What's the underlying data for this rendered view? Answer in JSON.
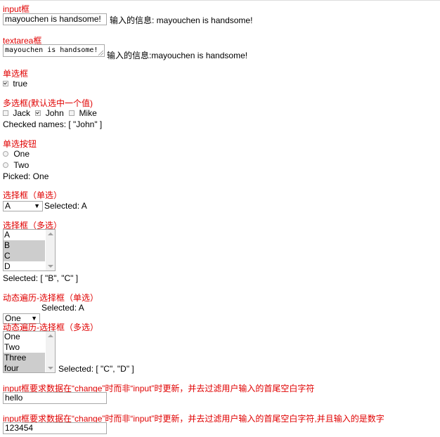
{
  "input_section": {
    "label": "input框",
    "value": "mayouchen is handsome!",
    "info": "输入的信息: mayouchen is handsome!"
  },
  "textarea_section": {
    "label": "textarea框",
    "value": "mayouchen is handsome!",
    "info": "输入的信息:mayouchen is handsome!"
  },
  "single_checkbox": {
    "label": "单选框",
    "text": "true",
    "checked": true
  },
  "multi_checkbox": {
    "label": "多选框(默认选中一个值)",
    "items": [
      {
        "name": "Jack",
        "checked": false
      },
      {
        "name": "John",
        "checked": true
      },
      {
        "name": "Mike",
        "checked": false
      }
    ],
    "result": "Checked names: [ \"John\" ]"
  },
  "radio_section": {
    "label": "单选按钮",
    "items": [
      {
        "name": "One",
        "checked": false
      },
      {
        "name": "Two",
        "checked": false
      }
    ],
    "result": "Picked: One"
  },
  "select_single": {
    "label": "选择框（单选）",
    "value": "A",
    "result": "Selected: A"
  },
  "select_multi": {
    "label": "选择框（多选）",
    "options": [
      {
        "text": "A",
        "selected": false
      },
      {
        "text": "B",
        "selected": true
      },
      {
        "text": "C",
        "selected": true
      },
      {
        "text": "D",
        "selected": false
      }
    ],
    "result": "Selected: [ \"B\", \"C\" ]"
  },
  "dyn_select_single": {
    "label": "动态遍历-选择框（单选）",
    "value": "One",
    "result": "Selected: A"
  },
  "dyn_select_multi": {
    "label": "动态遍历-选择框（多选）",
    "options": [
      {
        "text": "One",
        "selected": false
      },
      {
        "text": "Two",
        "selected": false
      },
      {
        "text": "Three",
        "selected": true
      },
      {
        "text": "four",
        "selected": true
      }
    ],
    "result": "Selected: [ \"C\", \"D\" ]"
  },
  "lazy_input": {
    "label": "input框要求数据在“change”时而非“input”时更新，并去过滤用户输入的首尾空白字符",
    "value": "hello"
  },
  "number_input": {
    "label": "input框要求数据在“change”时而非“input”时更新，并去过滤用户输入的首尾空白字符,并且输入的是数字",
    "value": "123454"
  },
  "colors": {
    "label_red": "#e00000",
    "selected_option_bg": "#cdcdcd",
    "border_gray": "#a9a9a9"
  }
}
